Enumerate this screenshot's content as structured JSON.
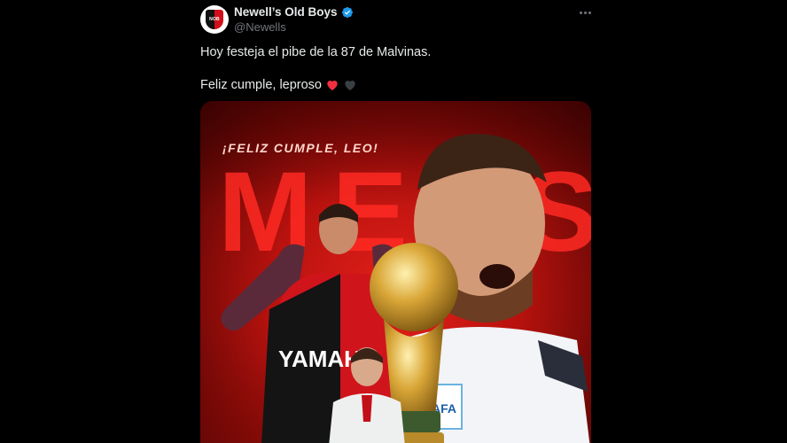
{
  "tweet": {
    "avatar_text": "NOB",
    "display_name": "Newell’s Old Boys",
    "handle": "@Newells",
    "line1": "Hoy festeja el pibe de la 87 de Malvinas.",
    "line2": "Feliz cumple, leproso",
    "emojis": [
      "red-heart-icon",
      "black-heart-icon"
    ]
  },
  "media": {
    "banner": "¡FELIZ CUMPLE, LEO!",
    "big_word": "MESSI",
    "shirt_text": "YAMAHA",
    "badge_text": "AFA",
    "colors": {
      "red": "#e4201a",
      "dark_red": "#6a0806",
      "verified": "#1d9bf0"
    }
  }
}
